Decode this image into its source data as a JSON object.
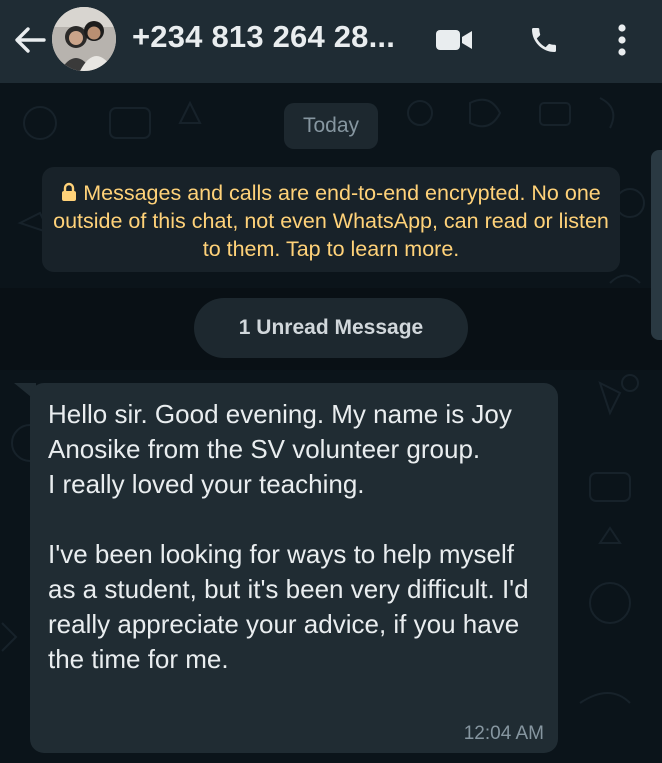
{
  "header": {
    "back_icon": "arrow-left-icon",
    "contact_name": "+234 813 264 28...",
    "video_icon": "video-camera-icon",
    "call_icon": "phone-icon",
    "menu_icon": "more-vertical-icon"
  },
  "chat": {
    "date_label": "Today",
    "encryption_notice": {
      "lock_icon": "lock-icon",
      "text": "Messages and calls are end-to-end encrypted. No one outside of this chat, not even WhatsApp, can read or listen to them. Tap to learn more."
    },
    "unread_label": "1 Unread Message",
    "messages": [
      {
        "direction": "incoming",
        "text": "Hello sir. Good evening. My name is Joy Anosike from the SV volunteer group.\nI really loved your teaching.\n\nI've been looking for ways to help myself as a student, but it's been very difficult. I'd really appreciate your advice, if you have the time for me.",
        "time": "12:04 AM"
      }
    ]
  },
  "colors": {
    "header_bg": "#1f2c34",
    "wallpaper_bg": "#0b141a",
    "bubble_incoming": "#202c33",
    "encryption_text": "#ffd279",
    "meta_text": "#8696a0"
  }
}
